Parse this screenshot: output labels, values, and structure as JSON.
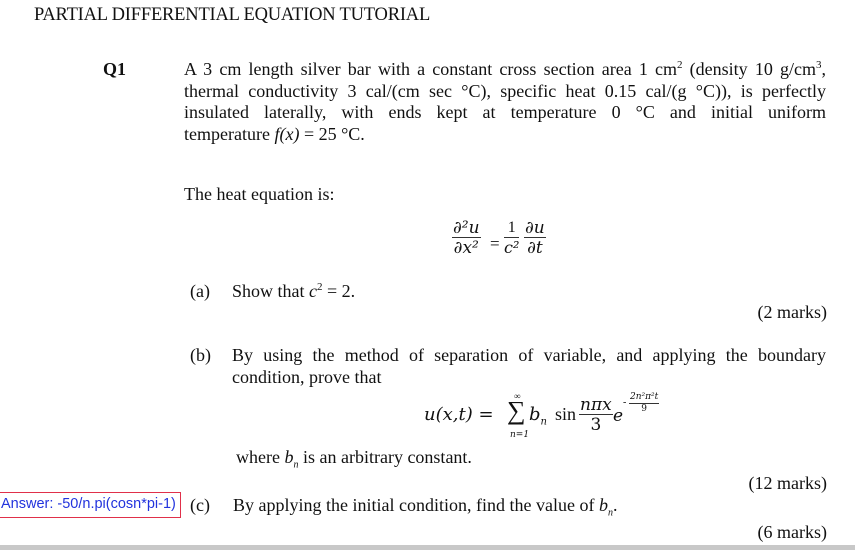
{
  "document": {
    "title": "PARTIAL DIFFERENTIAL  EQUATION TUTORIAL",
    "question_number": "Q1",
    "problem_lines": [
      {
        "pre": "A 3 cm length silver bar with a constant cross section area 1 cm",
        "sup1": "2",
        "mid": " (density 10 g/cm",
        "sup2": "3",
        "post": ","
      },
      {
        "text": "thermal conductivity 3 cal/(cm sec °C), specific heat 0.15 cal/(g °C)), is perfectly"
      },
      {
        "text": "insulated laterally, with ends kept at temperature 0 °C and initial uniform"
      },
      {
        "pre": "temperature ",
        "fx": "f(x)",
        "post": " = 25 °C."
      }
    ],
    "heat_intro": "The heat equation is:",
    "heat_equation": {
      "lhs_num": "∂²u",
      "lhs_den": "∂x²",
      "equals": "=",
      "coef_num": "1",
      "coef_den": "c²",
      "rhs_num": "∂u",
      "rhs_den": "∂t"
    },
    "parts": [
      {
        "label": "(a)",
        "text_pre": "Show that ",
        "text_var": "c",
        "text_sup": "2",
        "text_post": " = 2.",
        "marks": "(2 marks)"
      },
      {
        "label": "(b)",
        "lines": [
          "By using the method of separation of variable, and applying the boundary",
          "condition, prove that"
        ],
        "equation": {
          "lhs": "u(x,t) =",
          "sum_top": "∞",
          "sum_sym": "∑",
          "sum_bottom": "n=1",
          "term": "b",
          "term_sub": "n",
          "func": "sin",
          "frac_num": "nπx",
          "frac_den": "3",
          "exp_base": "e",
          "exp_sign": "-",
          "exp_num": "2n²π²t",
          "exp_den": "9"
        },
        "where_pre": "where ",
        "where_var": "b",
        "where_sub": "n",
        "where_post": " is an arbitrary constant.",
        "marks": "(12 marks)"
      },
      {
        "label": "(c)",
        "text_pre": "By applying the initial condition, find the value of ",
        "text_var": "b",
        "text_sub": "n",
        "text_post": ".",
        "marks": "(6 marks)"
      }
    ]
  },
  "annotation": {
    "answer_text": "Answer: -50/n.pi(cosn*pi-1)",
    "border_color": "#e0304a",
    "text_color": "#2233dd"
  }
}
